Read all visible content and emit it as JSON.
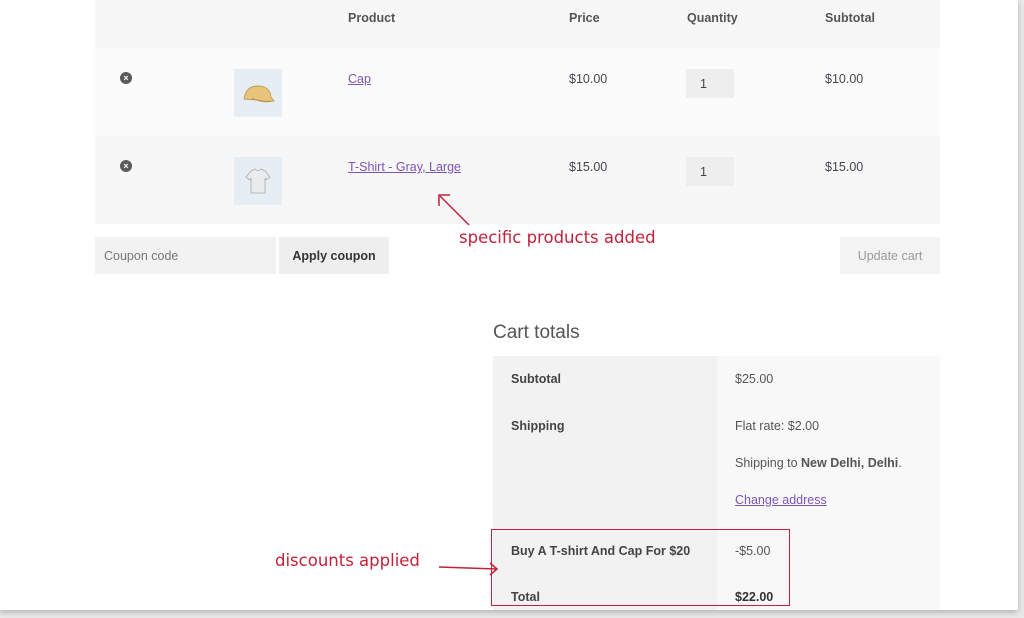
{
  "table": {
    "headers": {
      "product": "Product",
      "price": "Price",
      "quantity": "Quantity",
      "subtotal": "Subtotal"
    },
    "items": [
      {
        "remove_icon": "close-circle-icon",
        "name": "Cap",
        "price": "$10.00",
        "quantity": "1",
        "subtotal": "$10.00",
        "thumb_icon": "cap-icon"
      },
      {
        "remove_icon": "close-circle-icon",
        "name": "T-Shirt - Gray, Large",
        "price": "$15.00",
        "quantity": "1",
        "subtotal": "$15.00",
        "thumb_icon": "tshirt-icon"
      }
    ]
  },
  "coupon": {
    "placeholder": "Coupon code",
    "apply_label": "Apply coupon"
  },
  "update_label": "Update cart",
  "annotations": {
    "products": "specific products added",
    "discounts": "discounts applied",
    "color": "#c4213a"
  },
  "totals": {
    "title": "Cart totals",
    "subtotal_label": "Subtotal",
    "subtotal_value": "$25.00",
    "shipping_label": "Shipping",
    "shipping_method": "Flat rate: $2.00",
    "shipping_to_prefix": "Shipping to ",
    "shipping_location": "New Delhi, Delhi",
    "shipping_to_suffix": ".",
    "change_address": "Change address",
    "discount_label": "Buy A T-shirt And Cap For $20",
    "discount_value": "-$5.00",
    "total_label": "Total",
    "total_value": "$22.00"
  },
  "colors": {
    "link": "#7f54b3",
    "annotation": "#c4213a"
  }
}
